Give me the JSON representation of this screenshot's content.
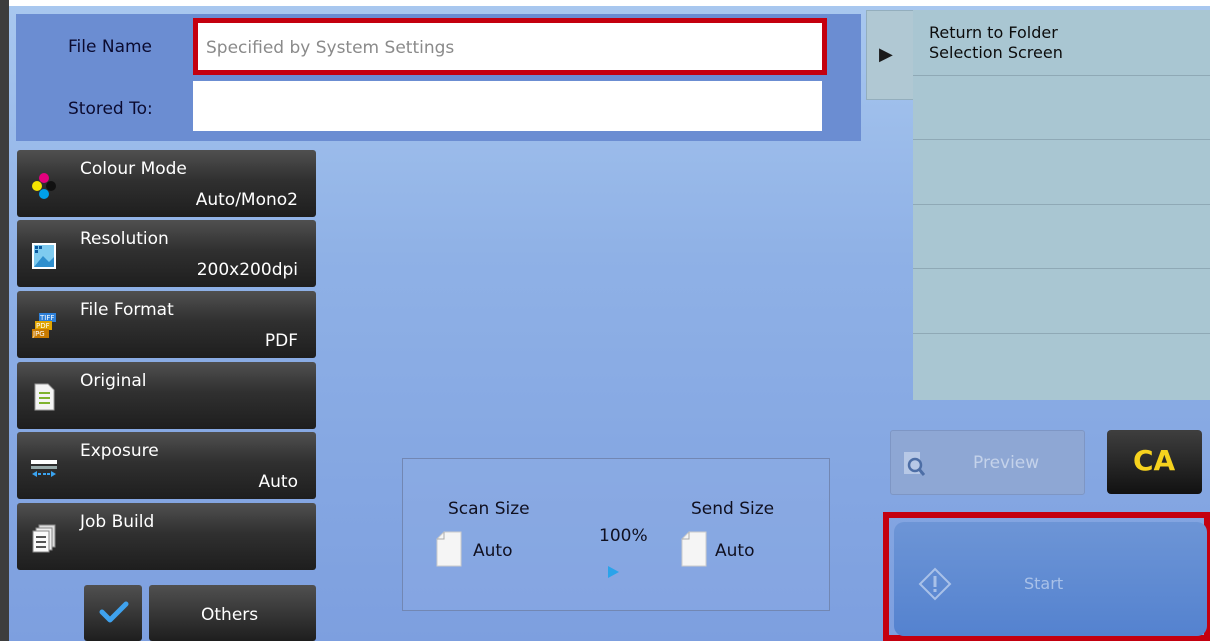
{
  "header": {
    "file_name_label": "File Name",
    "file_name_placeholder": "Specified by System Settings",
    "stored_to_label": "Stored To:",
    "stored_to_value": ""
  },
  "right_panel": {
    "tab_glyph": "▶",
    "rows": [
      "Return to Folder Selection Screen",
      "",
      "",
      "",
      "",
      ""
    ]
  },
  "functions": [
    {
      "title": "Colour Mode",
      "value": "Auto/Mono2",
      "icon": "colour-mode-icon"
    },
    {
      "title": "Resolution",
      "value": "200x200dpi",
      "icon": "resolution-icon"
    },
    {
      "title": "File Format",
      "value": "PDF",
      "icon": "file-format-icon"
    },
    {
      "title": "Original",
      "value": "",
      "icon": "original-icon"
    },
    {
      "title": "Exposure",
      "value": "Auto",
      "icon": "exposure-icon"
    },
    {
      "title": "Job Build",
      "value": "",
      "icon": "job-build-icon"
    }
  ],
  "bottom_left": {
    "others_label": "Others"
  },
  "scan_info": {
    "scan_size_label": "Scan Size",
    "scan_size_value": "Auto",
    "ratio": "100%",
    "send_size_label": "Send Size",
    "send_size_value": "Auto"
  },
  "actions": {
    "preview_label": "Preview",
    "ca_label": "CA",
    "start_label": "Start"
  },
  "colors": {
    "highlight_red": "#c4000f",
    "ca_yellow": "#f6d21e",
    "header_blue": "#6b8dd2"
  }
}
